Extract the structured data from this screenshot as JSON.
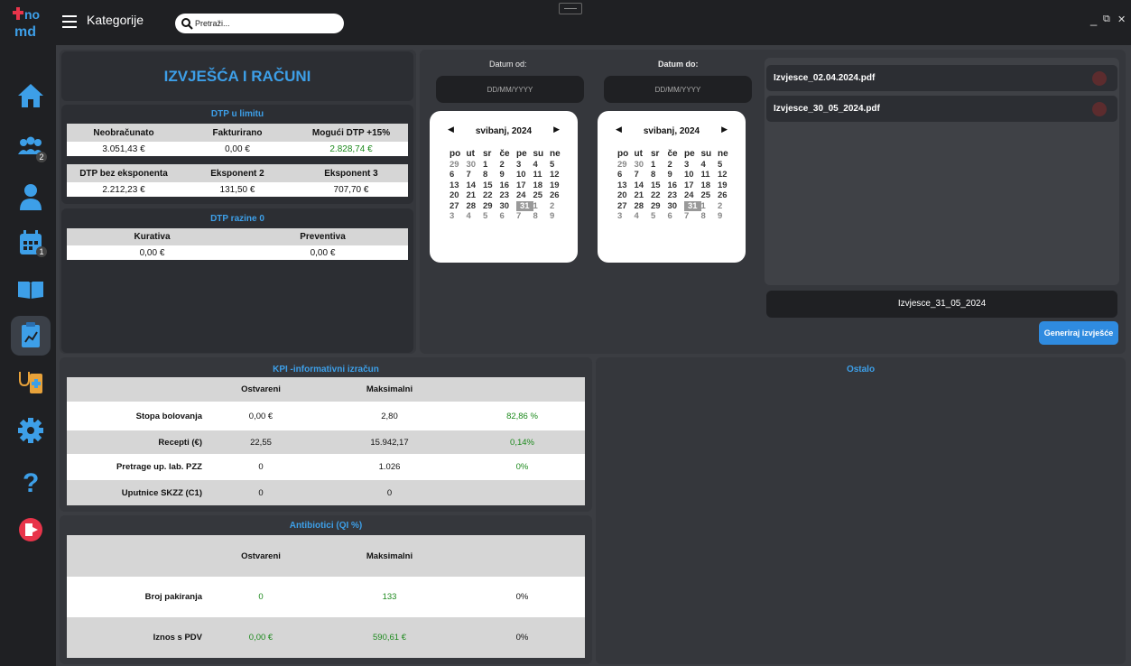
{
  "topbar": {
    "category_label": "Kategorije",
    "search_placeholder": "Pretraži...",
    "minimize": "_",
    "restore": "⧉",
    "close": "✕"
  },
  "sidebar": {
    "items": [
      {
        "name": "home",
        "badge": ""
      },
      {
        "name": "group",
        "badge": "2"
      },
      {
        "name": "person",
        "badge": ""
      },
      {
        "name": "calendar",
        "badge": "1"
      },
      {
        "name": "book",
        "badge": ""
      },
      {
        "name": "reports",
        "badge": ""
      },
      {
        "name": "medical",
        "badge": ""
      },
      {
        "name": "settings",
        "badge": ""
      },
      {
        "name": "help",
        "badge": ""
      },
      {
        "name": "logout",
        "badge": ""
      }
    ]
  },
  "page": {
    "title": "IZVJEŠĆA I RAČUNI"
  },
  "dtp_limit": {
    "title": "DTP u limitu",
    "headers1": [
      "Neobračunato",
      "Fakturirano",
      "Mogući DTP +15%"
    ],
    "values1": [
      "3.051,43 €",
      "0,00 €",
      "2.828,74 €"
    ],
    "headers2": [
      "DTP bez eksponenta",
      "Eksponent 2",
      "Eksponent 3"
    ],
    "values2": [
      "2.212,23 €",
      "131,50 €",
      "707,70 €"
    ]
  },
  "dtp_zero": {
    "title": "DTP razine 0",
    "headers": [
      "Kurativa",
      "Preventiva"
    ],
    "values": [
      "0,00 €",
      "0,00 €"
    ]
  },
  "dates": {
    "from_label": "Datum od:",
    "to_label": "Datum do:",
    "placeholder": "DD/MM/YYYY"
  },
  "calendar": {
    "month": "svibanj, 2024",
    "weekdays": [
      "po",
      "ut",
      "sr",
      "če",
      "pe",
      "su",
      "ne"
    ],
    "weeks": [
      [
        "29",
        "30",
        "1",
        "2",
        "3",
        "4",
        "5"
      ],
      [
        "6",
        "7",
        "8",
        "9",
        "10",
        "11",
        "12"
      ],
      [
        "13",
        "14",
        "15",
        "16",
        "17",
        "18",
        "19"
      ],
      [
        "20",
        "21",
        "22",
        "23",
        "24",
        "25",
        "26"
      ],
      [
        "27",
        "28",
        "29",
        "30",
        "31",
        "1",
        "2"
      ],
      [
        "3",
        "4",
        "5",
        "6",
        "7",
        "8",
        "9"
      ]
    ],
    "selected": "31"
  },
  "files": {
    "items": [
      "Izvjesce_02.04.2024.pdf",
      "Izvjesce_30_05_2024.pdf"
    ],
    "filename": "Izvjesce_31_05_2024",
    "generate_label": "Generiraj izvješće"
  },
  "kpi": {
    "title": "KPI -informativni izračun",
    "headers": [
      "",
      "Ostvareni",
      "Maksimalni",
      ""
    ],
    "rows": [
      {
        "label": "Stopa bolovanja",
        "ostvareni": "0,00 €",
        "maksimalni": "2,80",
        "pct": "82,86 %"
      },
      {
        "label": "Recepti (€)",
        "ostvareni": "22,55",
        "maksimalni": "15.942,17",
        "pct": "0,14%"
      },
      {
        "label": "Pretrage up. lab. PZZ",
        "ostvareni": "0",
        "maksimalni": "1.026",
        "pct": "0%"
      },
      {
        "label": "Uputnice SKZZ (C1)",
        "ostvareni": "0",
        "maksimalni": "0",
        "pct": ""
      }
    ]
  },
  "antibiotici": {
    "title": "Antibiotici (QI %)",
    "headers": [
      "",
      "Ostvareni",
      "Maksimalni",
      ""
    ],
    "rows": [
      {
        "label": "Broj pakiranja",
        "ostvareni": "0",
        "maksimalni": "133",
        "pct": "0%"
      },
      {
        "label": "Iznos s PDV",
        "ostvareni": "0,00 €",
        "maksimalni": "590,61 €",
        "pct": "0%"
      }
    ]
  },
  "ostalo": {
    "title": "Ostalo"
  },
  "colors": {
    "accent": "#3d9fe8",
    "background": "#1f2023",
    "panel": "#35373c",
    "green": "#1d8a1d"
  }
}
